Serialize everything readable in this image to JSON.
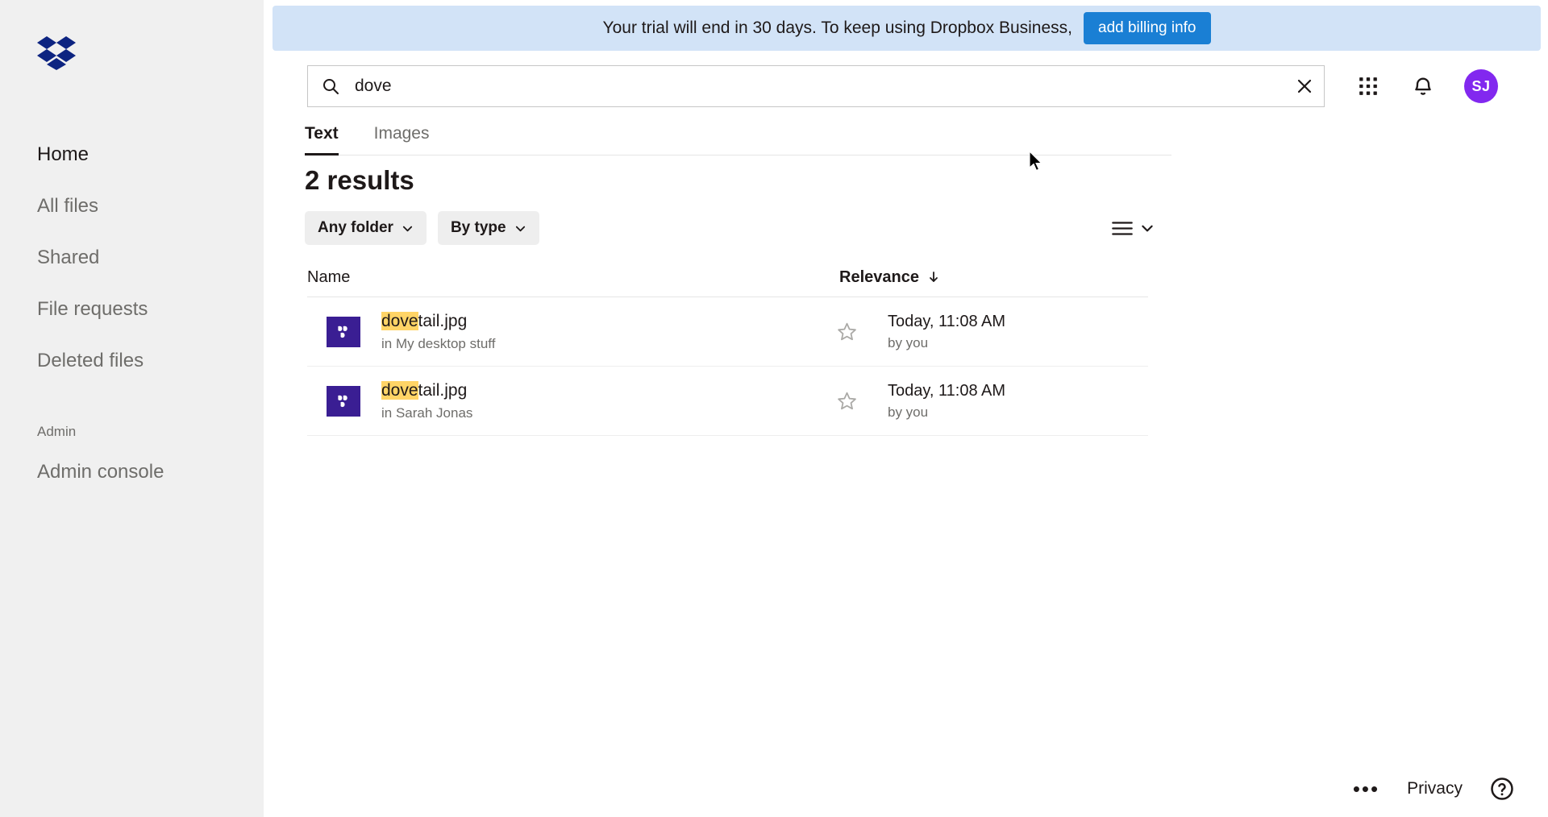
{
  "banner": {
    "message": "Your trial will end in 30 days. To keep using Dropbox Business,",
    "cta_label": "add billing info",
    "bg_color": "#d2e3f7",
    "cta_color": "#1a7fd4"
  },
  "search": {
    "value": "dove",
    "placeholder": "Search",
    "icon": "search-icon",
    "clear_icon": "close-icon"
  },
  "header": {
    "apps_icon": "grid-apps-icon",
    "notifications_icon": "bell-icon",
    "avatar_initials": "SJ",
    "avatar_color": "#8228ef"
  },
  "sidebar": {
    "logo": "dropbox-logo",
    "logo_color": "#0d2481",
    "bg_color": "#f0f0f0",
    "items": [
      {
        "label": "Home",
        "active": true
      },
      {
        "label": "All files",
        "active": false
      },
      {
        "label": "Shared",
        "active": false
      },
      {
        "label": "File requests",
        "active": false
      },
      {
        "label": "Deleted files",
        "active": false
      }
    ],
    "section_label": "Admin",
    "admin_items": [
      {
        "label": "Admin console",
        "active": false
      }
    ]
  },
  "tabs": [
    {
      "label": "Text",
      "active": true
    },
    {
      "label": "Images",
      "active": false
    }
  ],
  "results": {
    "heading": "2 results",
    "count": 2,
    "filters": [
      {
        "label": "Any folder",
        "icon": "chevron-down-icon"
      },
      {
        "label": "By type",
        "icon": "chevron-down-icon"
      }
    ],
    "view_toggle": {
      "icon": "list-view-icon",
      "chevron": "chevron-down-icon"
    },
    "columns": {
      "name": "Name",
      "relevance": "Relevance",
      "sort_direction_icon": "arrow-down-icon"
    },
    "rows": [
      {
        "name_highlight": "dove",
        "name_rest": "tail.jpg",
        "location": "in My desktop stuff",
        "date": "Today, 11:08 AM",
        "author": "by you",
        "starred": false,
        "thumb_color": "#3a1e93"
      },
      {
        "name_highlight": "dove",
        "name_rest": "tail.jpg",
        "location": "in Sarah Jonas",
        "date": "Today, 11:08 AM",
        "author": "by you",
        "starred": false,
        "thumb_color": "#3a1e93"
      }
    ],
    "highlight_color": "#ffd466"
  },
  "footer": {
    "more_label": "•••",
    "privacy_label": "Privacy",
    "help_icon": "question-circle-icon"
  }
}
